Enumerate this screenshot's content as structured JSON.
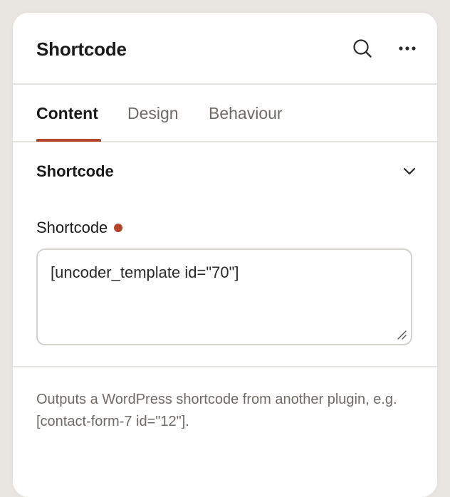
{
  "panel": {
    "title": "Shortcode",
    "actions": [
      {
        "icon": "search-icon"
      },
      {
        "icon": "more-horizontal-icon"
      }
    ]
  },
  "tabs": [
    {
      "label": "Content",
      "active": true
    },
    {
      "label": "Design",
      "active": false
    },
    {
      "label": "Behaviour",
      "active": false
    }
  ],
  "section": {
    "title": "Shortcode",
    "expanded": true,
    "toggle_icon": "chevron-down-icon",
    "field": {
      "label": "Shortcode",
      "required": true,
      "value": "[uncoder_template id=\"70\"]"
    }
  },
  "description": "Outputs a WordPress shortcode from another plugin, e.g. [contact-form-7 id=\"12\"].",
  "colors": {
    "accent": "#b5442d",
    "text": "#1a1a1a",
    "muted": "#6f6a66",
    "border": "#e6e4e1",
    "background": "#e9e6e2"
  }
}
